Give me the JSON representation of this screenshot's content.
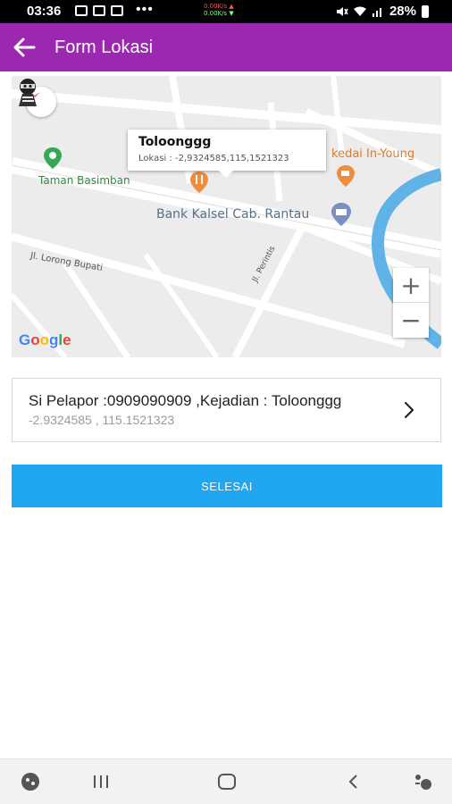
{
  "status_bar": {
    "time": "03:36",
    "more_indicator": "•••",
    "net_speed_up": "0.00K/s ▲",
    "net_speed_down": "0.00K/s ▼",
    "battery_text": "28%"
  },
  "app_bar": {
    "title": "Form Lokasi",
    "back_icon": "arrow-left-icon",
    "color": "#9C27B0"
  },
  "map": {
    "info_window": {
      "title": "Toloonggg",
      "subtitle": "Lokasi : -2,9324585,115,1521323"
    },
    "labels": {
      "park": "Taman Basimban",
      "cafe": "kedai In-Young",
      "bank": "Bank Kalsel Cab. Rantau",
      "street1": "Jl. Lorong Bupati",
      "street2": "Jl. Perintis"
    },
    "zoom_in": "+",
    "zoom_out": "−",
    "attribution": "Google",
    "marker_icon": "thief-marker-icon"
  },
  "report_card": {
    "title": "Si Pelapor :0909090909 ,Kejadian : Toloonggg",
    "coords": "-2.9324585 , 115.1521323",
    "chevron_icon": "chevron-right-icon"
  },
  "finish_button": {
    "label": "SELESAI",
    "color": "#1EA7F0"
  },
  "nav_bar": {
    "icons": [
      "game-launcher-icon",
      "recents-icon",
      "home-icon",
      "back-icon",
      "accessibility-icon"
    ]
  }
}
